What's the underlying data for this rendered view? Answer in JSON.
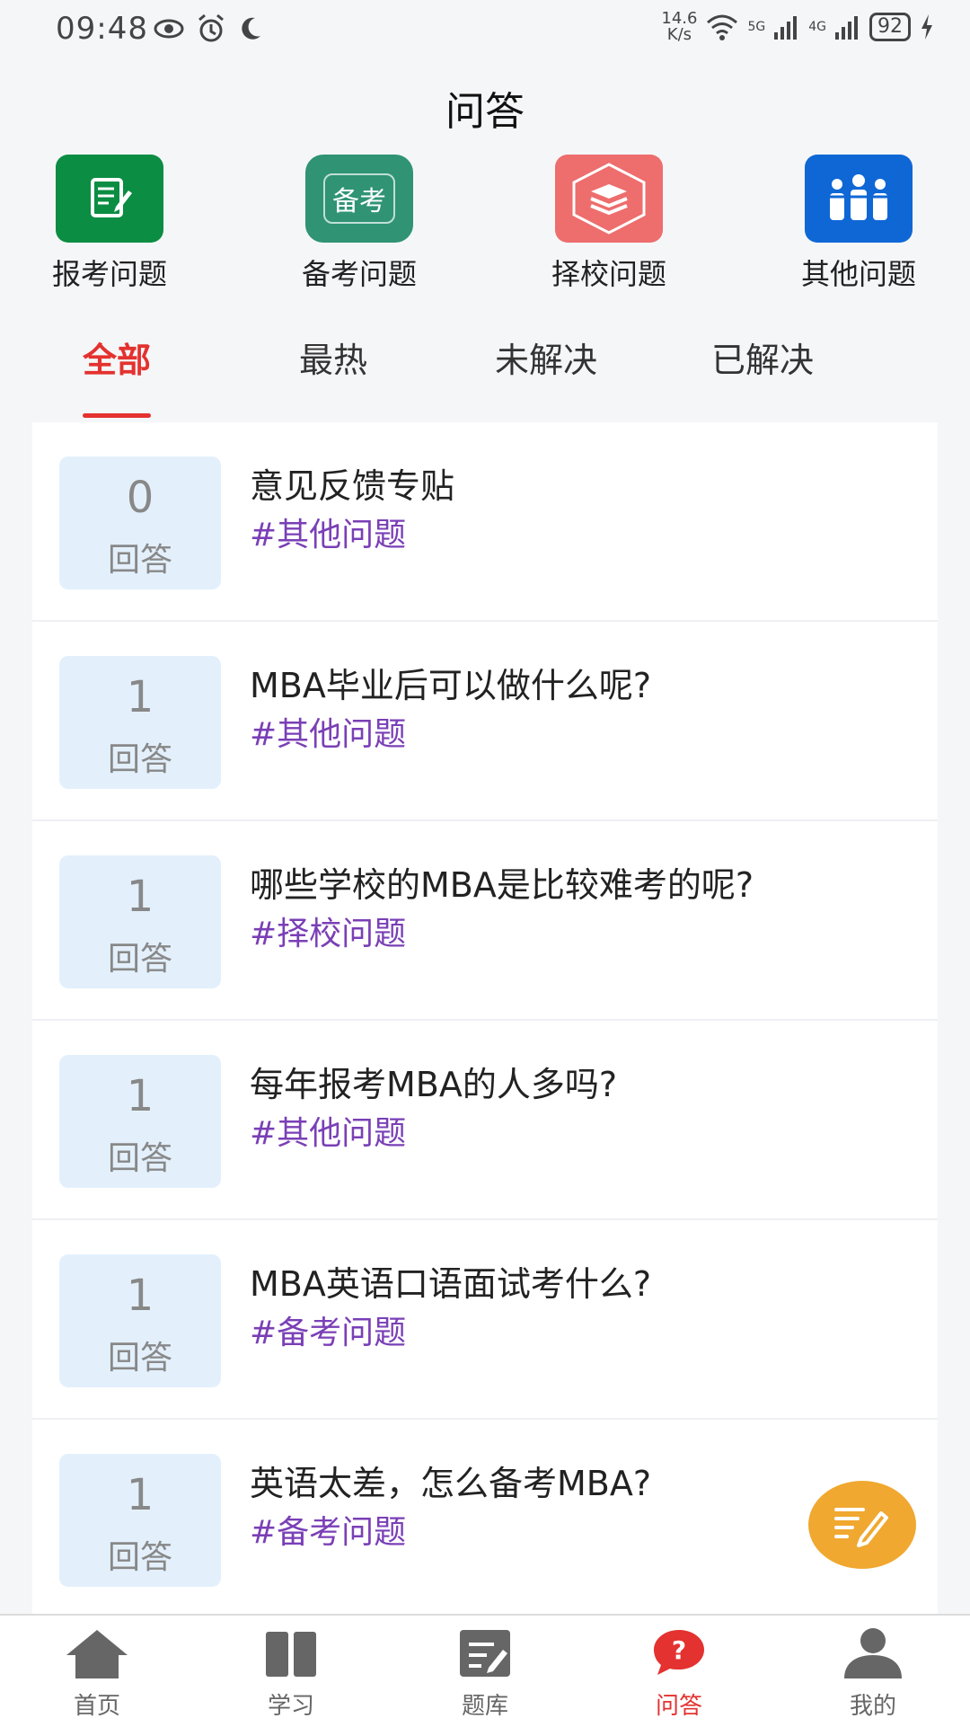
{
  "status": {
    "time": "09:48",
    "speed_top": "14.6",
    "speed_unit": "K/s",
    "net5g": "5G",
    "net4g": "4G",
    "battery": "92"
  },
  "page_title": "问答",
  "categories": [
    {
      "label": "报考问题",
      "icon": "edit-form-icon",
      "color": "#0b8d43"
    },
    {
      "label": "备考问题",
      "icon": "prep-icon",
      "icon_text": "备考",
      "color": "#2f9374"
    },
    {
      "label": "择校问题",
      "icon": "books-icon",
      "color": "#ee6d6d"
    },
    {
      "label": "其他问题",
      "icon": "people-icon",
      "color": "#0f67d6"
    }
  ],
  "tabs": [
    {
      "label": "全部",
      "active": true
    },
    {
      "label": "最热",
      "active": false
    },
    {
      "label": "未解决",
      "active": false
    },
    {
      "label": "已解决",
      "active": false
    }
  ],
  "questions": [
    {
      "count": "0",
      "count_label": "回答",
      "title": "意见反馈专贴",
      "tag": "#其他问题"
    },
    {
      "count": "1",
      "count_label": "回答",
      "title": "MBA毕业后可以做什么呢?",
      "tag": "#其他问题"
    },
    {
      "count": "1",
      "count_label": "回答",
      "title": "哪些学校的MBA是比较难考的呢?",
      "tag": "#择校问题"
    },
    {
      "count": "1",
      "count_label": "回答",
      "title": "每年报考MBA的人多吗?",
      "tag": "#其他问题"
    },
    {
      "count": "1",
      "count_label": "回答",
      "title": "MBA英语口语面试考什么?",
      "tag": "#备考问题"
    },
    {
      "count": "1",
      "count_label": "回答",
      "title": "英语太差，怎么备考MBA?",
      "tag": "#备考问题"
    }
  ],
  "fab_icon": "compose-icon",
  "bottom_nav": [
    {
      "label": "首页",
      "icon": "home-icon",
      "active": false
    },
    {
      "label": "学习",
      "icon": "book-icon",
      "active": false
    },
    {
      "label": "题库",
      "icon": "question-bank-icon",
      "active": false
    },
    {
      "label": "问答",
      "icon": "qa-icon",
      "active": true
    },
    {
      "label": "我的",
      "icon": "user-icon",
      "active": false
    }
  ],
  "colors": {
    "accent": "#e3322f",
    "tag": "#7a3fb6",
    "count_bg": "#e3f0fc",
    "fab": "#f0a830"
  }
}
